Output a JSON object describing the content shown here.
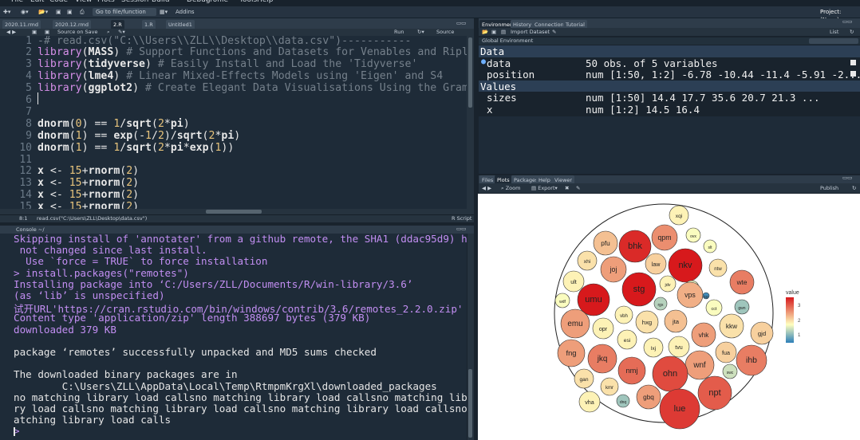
{
  "menu": [
    "File",
    "Edit",
    "Code",
    "View",
    "Plots",
    "Session",
    "Build",
    "Debug",
    "Profile",
    "Tools",
    "Help"
  ],
  "toolbar": {
    "goto_placeholder": "Go to file/function",
    "addins": "Addins",
    "project": "Project: (None)"
  },
  "editor": {
    "tabs": [
      "2020.11.rmd",
      "2020.12.rmd",
      "2.R",
      "1.R",
      "Untitled1"
    ],
    "source_on_save": "Source on Save",
    "run": "Run",
    "source": "Source",
    "status_pos": "8:1",
    "status_fn": "read.csv(\"C:\\Users\\ZLL\\Desktop\\data.csv\")",
    "status_type": "R Script"
  },
  "code_lines": [
    {
      "n": "1",
      "html": "<span class=\"cm\">-# read.csv(\"C:\\\\Users\\\\ZLL\\\\Desktop\\\\data.csv\")-----------</span>"
    },
    {
      "n": "2",
      "html": "<span class=\"kw\">library</span>(<b>MASS</b>) <span class=\"cm\"># Support Functions and Datasets for Venables and Ripley's M</span>"
    },
    {
      "n": "3",
      "html": "<span class=\"kw\">library</span>(<b>tidyverse</b>) <span class=\"cm\"># Easily Install and Load the 'Tidyverse'</span>"
    },
    {
      "n": "4",
      "html": "<span class=\"kw\">library</span>(<b>lme4</b>) <span class=\"cm\"># Linear Mixed-Effects Models using 'Eigen' and S4</span>"
    },
    {
      "n": "5",
      "html": "<span class=\"kw\">library</span>(<b>ggplot2</b>) <span class=\"cm\"># Create Elegant Data Visualisations Using the Grammar of</span>"
    },
    {
      "n": "6",
      "html": ""
    },
    {
      "n": "7",
      "html": ""
    },
    {
      "n": "8",
      "html": "<b>dnorm</b>(<span class=\"nu\">0</span>) == <span class=\"nu\">1</span>/<b>sqrt</b>(<span class=\"nu\">2</span>*<b>pi</b>)"
    },
    {
      "n": "9",
      "html": "<b>dnorm</b>(<span class=\"nu\">1</span>) == <b>exp</b>(-<span class=\"nu\">1</span>/<span class=\"nu\">2</span>)/<b>sqrt</b>(<span class=\"nu\">2</span>*<b>pi</b>)"
    },
    {
      "n": "10",
      "html": "<b>dnorm</b>(<span class=\"nu\">1</span>) == <span class=\"nu\">1</span>/<b>sqrt</b>(<span class=\"nu\">2</span>*<b>pi</b>*<b>exp</b>(<span class=\"nu\">1</span>))"
    },
    {
      "n": "11",
      "html": ""
    },
    {
      "n": "12",
      "html": "<b>x</b> &lt;- <span class=\"nu\">15</span>+<b>rnorm</b>(<span class=\"nu\">2</span>)"
    },
    {
      "n": "13",
      "html": "<b>x</b> &lt;- <span class=\"nu\">15</span>+<b>rnorm</b>(<span class=\"nu\">2</span>)"
    },
    {
      "n": "14",
      "html": "<b>x</b> &lt;- <span class=\"nu\">15</span>+<b>rnorm</b>(<span class=\"nu\">2</span>)"
    },
    {
      "n": "15",
      "html": "<b>x</b> &lt;- <span class=\"nu\">15</span>+<b>rnorm</b>(<span class=\"nu\">2</span>)"
    },
    {
      "n": "16",
      "html": ""
    }
  ],
  "console": {
    "title": "Console ~/",
    "lines": [
      {
        "c": "pur",
        "t": "Skipping install of 'annotater' from a github remote, the SHA1 (ddac95d9) has"
      },
      {
        "c": "pur",
        "t": " not changed since last install."
      },
      {
        "c": "pur",
        "t": "  Use `force = TRUE` to force installation"
      },
      {
        "c": "pur",
        "t": "> install.packages(\"remotes\")"
      },
      {
        "c": "pur",
        "t": "Installing package into ‘C:/Users/ZLL/Documents/R/win-library/3.6’"
      },
      {
        "c": "pur",
        "t": "(as ‘lib’ is unspecified)"
      },
      {
        "c": "pur",
        "t": "试开URL'https://cran.rstudio.com/bin/windows/contrib/3.6/remotes_2.2.0.zip'"
      },
      {
        "c": "pur",
        "t": "Content type 'application/zip' length 388697 bytes (379 KB)"
      },
      {
        "c": "pur",
        "t": "downloaded 379 KB"
      },
      {
        "c": "wht",
        "t": ""
      },
      {
        "c": "wht",
        "t": "package ‘remotes’ successfully unpacked and MD5 sums checked"
      },
      {
        "c": "wht",
        "t": ""
      },
      {
        "c": "wht",
        "t": "The downloaded binary packages are in"
      },
      {
        "c": "wht",
        "t": "        C:\\Users\\ZLL\\AppData\\Local\\Temp\\RtmpmKrgXl\\downloaded_packages"
      },
      {
        "c": "wht",
        "t": "no matching library load callsno matching library load callsno matching libra"
      },
      {
        "c": "wht",
        "t": "ry load callsno matching library load callsno matching library load callsno m"
      },
      {
        "c": "wht",
        "t": "atching library load calls"
      },
      {
        "c": "pur",
        "t": "> "
      }
    ]
  },
  "env": {
    "tabs": [
      "Environment",
      "History",
      "Connections",
      "Tutorial"
    ],
    "import": "Import Dataset",
    "list": "List",
    "scope": "Global Environment",
    "sections": [
      {
        "title": "Data",
        "rows": [
          {
            "name": "data",
            "value": "50 obs. of 5 variables",
            "bullet": true
          },
          {
            "name": "position",
            "value": "num [1:50, 1:2] -6.78 -10.44 -11.4 -5.91 -2...."
          }
        ]
      },
      {
        "title": "Values",
        "rows": [
          {
            "name": "sizes",
            "value": "num [1:50] 14.4 17.7 35.6 20.7 21.3 ..."
          },
          {
            "name": "x",
            "value": "num [1:2] 14.5 16.4"
          }
        ]
      }
    ]
  },
  "plots": {
    "tabs": [
      "Files",
      "Plots",
      "Packages",
      "Help",
      "Viewer"
    ],
    "zoom": "Zoom",
    "export": "Export",
    "publish": "Publish",
    "legend_title": "value",
    "legend_ticks": [
      "3",
      "2",
      "1"
    ]
  },
  "colors": {
    "low": "#2c7fb8",
    "mid": "#ffffbf",
    "high": "#d7191c"
  },
  "chart_data": {
    "type": "packed-circles",
    "legend_title": "value",
    "legend_ticks": [
      1,
      2,
      3
    ],
    "nodes": [
      {
        "label": "xqi",
        "value": 2.0
      },
      {
        "label": "pfu",
        "value": 2.3
      },
      {
        "label": "bhk",
        "value": 3.2
      },
      {
        "label": "qpm",
        "value": 2.6
      },
      {
        "label": "ovx",
        "value": 1.9
      },
      {
        "label": "slt",
        "value": 1.9
      },
      {
        "label": "xhi",
        "value": 2.1
      },
      {
        "label": "joj",
        "value": 2.5
      },
      {
        "label": "law",
        "value": 2.2
      },
      {
        "label": "nkv",
        "value": 3.3
      },
      {
        "label": "ntw",
        "value": 2.1
      },
      {
        "label": "ult",
        "value": 2.0
      },
      {
        "label": "stg",
        "value": 3.3
      },
      {
        "label": "jdv",
        "value": 2.0
      },
      {
        "label": "hdg",
        "value": 1.8
      },
      {
        "label": "wte",
        "value": 2.7
      },
      {
        "label": "wdf",
        "value": 1.9
      },
      {
        "label": "umu",
        "value": 3.3
      },
      {
        "label": "vps",
        "value": 2.4
      },
      {
        "label": "kg",
        "value": 1.1
      },
      {
        "label": "rgx",
        "value": 1.6
      },
      {
        "label": "cct",
        "value": 1.9
      },
      {
        "label": "gwn",
        "value": 1.5
      },
      {
        "label": "vbh",
        "value": 2.0
      },
      {
        "label": "emu",
        "value": 2.5
      },
      {
        "label": "hxg",
        "value": 2.1
      },
      {
        "label": "jta",
        "value": 2.3
      },
      {
        "label": "vhk",
        "value": 2.5
      },
      {
        "label": "kkw",
        "value": 2.1
      },
      {
        "label": "opr",
        "value": 2.0
      },
      {
        "label": "esi",
        "value": 2.0
      },
      {
        "label": "gjd",
        "value": 2.2
      },
      {
        "label": "lxj",
        "value": 2.0
      },
      {
        "label": "tvu",
        "value": 2.0
      },
      {
        "label": "fua",
        "value": 2.2
      },
      {
        "label": "fng",
        "value": 2.5
      },
      {
        "label": "jkq",
        "value": 2.7
      },
      {
        "label": "wnf",
        "value": 2.5
      },
      {
        "label": "ihb",
        "value": 2.7
      },
      {
        "label": "nmj",
        "value": 2.8
      },
      {
        "label": "ohn",
        "value": 3.0
      },
      {
        "label": "swc",
        "value": 1.7
      },
      {
        "label": "gan",
        "value": 2.1
      },
      {
        "label": "kmr",
        "value": 2.1
      },
      {
        "label": "npt",
        "value": 2.9
      },
      {
        "label": "vha",
        "value": 2.0
      },
      {
        "label": "dnq",
        "value": 1.5
      },
      {
        "label": "gbq",
        "value": 2.5
      },
      {
        "label": "lue",
        "value": 3.1
      }
    ]
  }
}
